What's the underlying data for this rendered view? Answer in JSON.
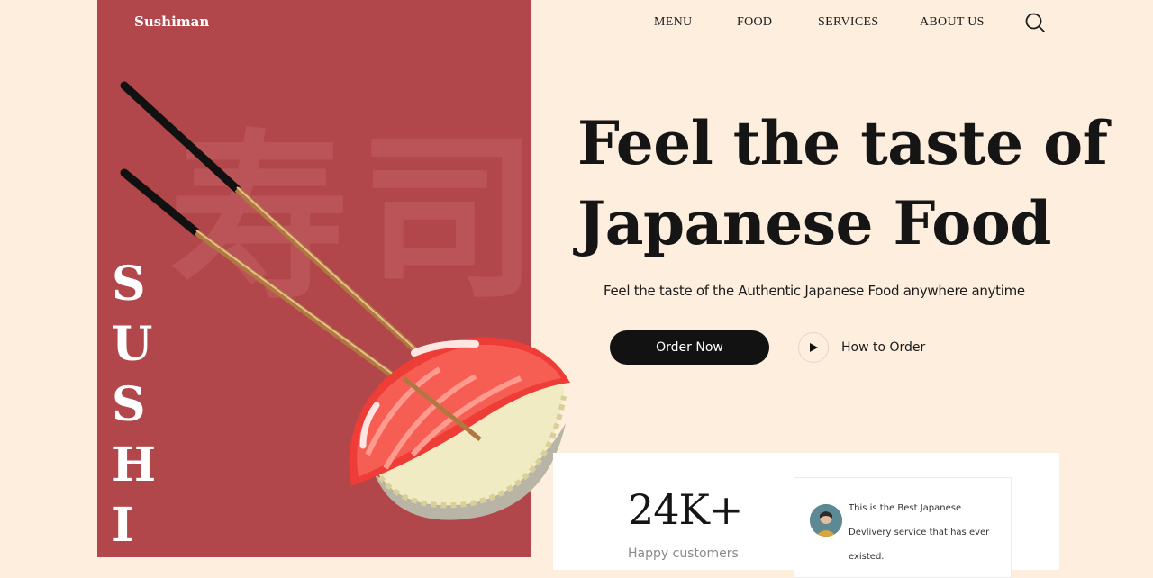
{
  "brand": {
    "logo": "Sushiman",
    "vertical_word": [
      "S",
      "U",
      "S",
      "H",
      "I"
    ],
    "kanji": "寿司"
  },
  "nav": {
    "items": [
      "MENU",
      "FOOD",
      "SERVICES",
      "ABOUT US"
    ]
  },
  "hero": {
    "headline_line1": "Feel the taste of",
    "headline_line2": "Japanese Food",
    "subline": "Feel the taste of the Authentic Japanese Food anywhere anytime",
    "order_button": "Order Now",
    "how_to_order": "How to Order"
  },
  "stats": {
    "value": "24K+",
    "label": "Happy customers",
    "testimonial": "This is the Best Japanese Devlivery service that has ever existed."
  },
  "colors": {
    "panel": "#b1474b",
    "background": "#fdeedd",
    "dark": "#121212"
  },
  "icons": {
    "search": "search-icon",
    "play": "play-icon"
  }
}
